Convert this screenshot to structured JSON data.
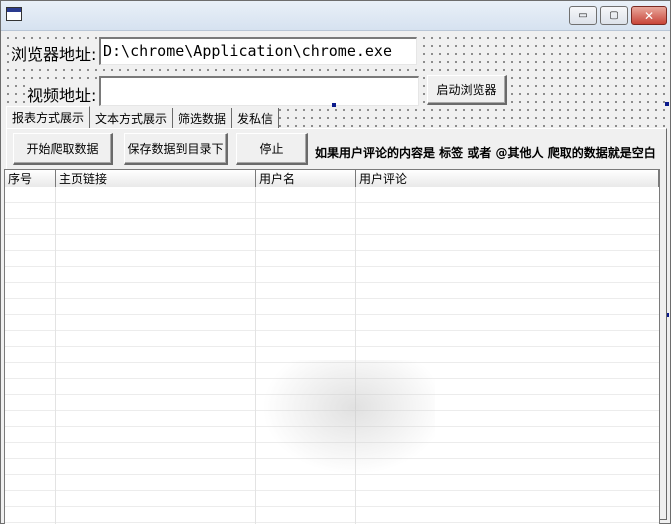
{
  "window": {
    "controls": {
      "minimize": "▭",
      "maximize": "▢",
      "close": "✕"
    }
  },
  "form": {
    "browser_label": "浏览器地址:",
    "browser_path": "D:\\chrome\\Application\\chrome.exe",
    "video_label": "视频地址:",
    "video_url": "",
    "launch_button": "启动浏览器"
  },
  "tabs": [
    {
      "label": "报表方式展示",
      "active": true
    },
    {
      "label": "文本方式展示",
      "active": false
    },
    {
      "label": "筛选数据",
      "active": false
    },
    {
      "label": "发私信",
      "active": false
    }
  ],
  "actions": {
    "start": "开始爬取数据",
    "save": "保存数据到目录下",
    "stop": "停止",
    "hint": "如果用户评论的内容是 标签 或者 @其他人 爬取的数据就是空白"
  },
  "table": {
    "columns": [
      "序号",
      "主页链接",
      "用户名",
      "用户评论"
    ],
    "rows": []
  }
}
